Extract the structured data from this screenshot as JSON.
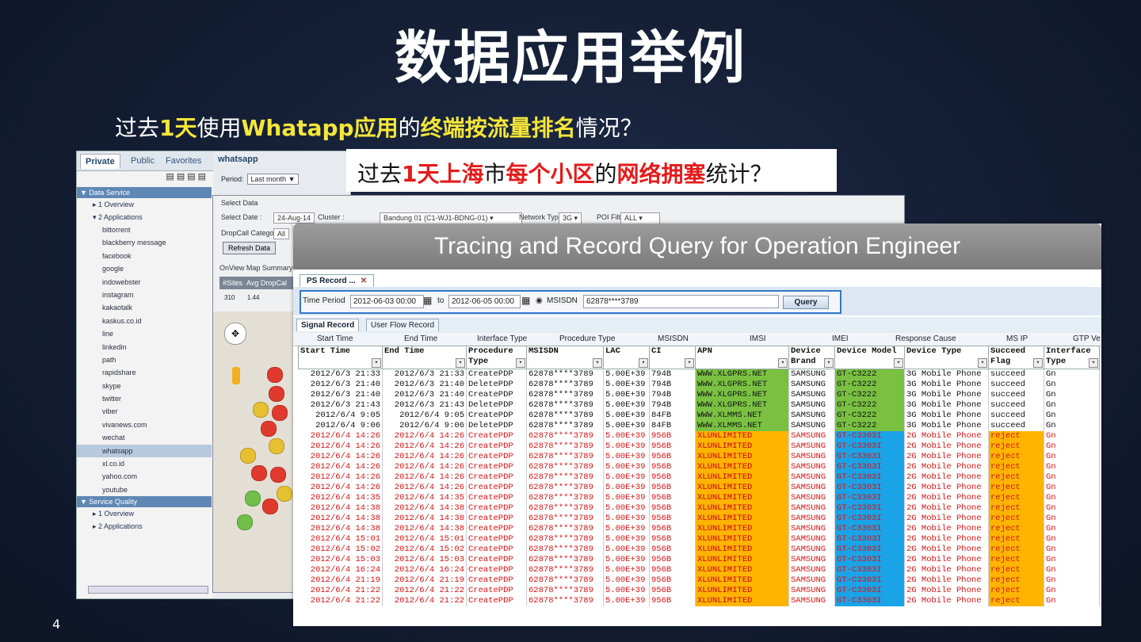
{
  "slide": {
    "title": "数据应用举例",
    "page_number": "4",
    "question1": {
      "p1": "过去",
      "p2": "1天",
      "p3": "使用",
      "p4": "Whatapp应用",
      "p5": "的",
      "p6": "终端按流量排名",
      "p7": "情况？"
    },
    "question2": {
      "p1": "过去",
      "p2": "1天上海",
      "p3": "市",
      "p4": "每个小区",
      "p5": "的",
      "p6": "网络拥塞",
      "p7": "统计？"
    }
  },
  "panel_apps": {
    "tabs": [
      "Private",
      "Public",
      "Favorites"
    ],
    "header": "whatsapp",
    "period_label": "Period:",
    "period_value": "Last month",
    "section1": "Data Service",
    "overview": "1 Overview",
    "applications": "2 Applications",
    "apps": [
      "bittorrent",
      "blackberry message",
      "facebook",
      "google",
      "indowebster",
      "instagram",
      "kakaotalk",
      "kaskus.co.id",
      "line",
      "linkedin",
      "path",
      "rapidshare",
      "skype",
      "twitter",
      "viber",
      "vivanews.com",
      "wechat",
      "whatsapp",
      "xl.co.id",
      "yahoo.com",
      "youtube"
    ],
    "selected_app": "whatsapp",
    "section2": "Service Quality",
    "sq_overview": "1 Overview",
    "sq_applications": "2 Applications"
  },
  "panel_map": {
    "select_data": "Select Data",
    "select_date_label": "Select Date :",
    "select_date_value": "24-Aug-14",
    "cluster_label": "Cluster :",
    "cluster_value": "Bandung 01 (C1-WJ1-BDNG-01)",
    "network_type_label": "Network Type",
    "network_type_value": "3G",
    "poi_filter_label": "POI Filter",
    "poi_filter_value": "ALL",
    "dropcall_label": "DropCall Category",
    "dropcall_value": "All",
    "refresh_button": "Refresh Data",
    "summary_label": "OnView Map Summary",
    "summary_headers": [
      "#Sites",
      "Avg DropCal"
    ],
    "summary_values": [
      "310",
      "1.44"
    ]
  },
  "panel_table": {
    "banner": "Tracing and Record Query for Operation Engineer",
    "tab": "PS Record ...",
    "time_period_label": "Time Period",
    "from": "2012-06-03 00:00",
    "to_label": "to",
    "to": "2012-06-05 00:00",
    "msisdn_label": "MSISDN",
    "msisdn_value": "62878****3789",
    "query_button": "Query",
    "subtabs": [
      "Signal Record",
      "User Flow Record"
    ],
    "top_columns": [
      "Start Time",
      "End Time",
      "Interface Type",
      "Procedure Type",
      "MSISDN",
      "IMSI",
      "IMEI",
      "Response Cause",
      "MS IP",
      "GTP Ve"
    ],
    "columns": [
      "Start Time",
      "End Time",
      "Procedure Type",
      "MSISDN",
      "LAC",
      "CI",
      "APN",
      "Device Brand",
      "Device Model",
      "Device Type",
      "Succeed Flag",
      "Interface Type"
    ],
    "rows": [
      [
        "2012/6/3 21:33",
        "2012/6/3 21:33",
        "CreatePDP",
        "62878****3789",
        "5.00E+39",
        "794B",
        "WWW.XLGPRS.NET",
        "SAMSUNG",
        "GT-C3222",
        "3G Mobile Phone",
        "succeed",
        "Gn"
      ],
      [
        "2012/6/3 21:40",
        "2012/6/3 21:40",
        "DeletePDP",
        "62878****3789",
        "5.00E+39",
        "794B",
        "WWW.XLGPRS.NET",
        "SAMSUNG",
        "GT-C3222",
        "3G Mobile Phone",
        "succeed",
        "Gn"
      ],
      [
        "2012/6/3 21:40",
        "2012/6/3 21:40",
        "CreatePDP",
        "62878****3789",
        "5.00E+39",
        "794B",
        "WWW.XLGPRS.NET",
        "SAMSUNG",
        "GT-C3222",
        "3G Mobile Phone",
        "succeed",
        "Gn"
      ],
      [
        "2012/6/3 21:43",
        "2012/6/3 21:43",
        "DeletePDP",
        "62878****3789",
        "5.00E+39",
        "794B",
        "WWW.XLGPRS.NET",
        "SAMSUNG",
        "GT-C3222",
        "3G Mobile Phone",
        "succeed",
        "Gn"
      ],
      [
        "2012/6/4 9:05",
        "2012/6/4 9:05",
        "CreatePDP",
        "62878****3789",
        "5.00E+39",
        "84FB",
        "WWW.XLMMS.NET",
        "SAMSUNG",
        "GT-C3222",
        "3G Mobile Phone",
        "succeed",
        "Gn"
      ],
      [
        "2012/6/4 9:06",
        "2012/6/4 9:06",
        "DeletePDP",
        "62878****3789",
        "5.00E+39",
        "84FB",
        "WWW.XLMMS.NET",
        "SAMSUNG",
        "GT-C3222",
        "3G Mobile Phone",
        "succeed",
        "Gn"
      ],
      [
        "2012/6/4 14:26",
        "2012/6/4 14:26",
        "CreatePDP",
        "62878****3789",
        "5.00E+39",
        "956B",
        "XLUNLIMITED",
        "SAMSUNG",
        "GT-C3303I",
        "2G Mobile Phone",
        "reject",
        "Gn"
      ],
      [
        "2012/6/4 14:26",
        "2012/6/4 14:26",
        "CreatePDP",
        "62878****3789",
        "5.00E+39",
        "956B",
        "XLUNLIMITED",
        "SAMSUNG",
        "GT-C3303I",
        "2G Mobile Phone",
        "reject",
        "Gn"
      ],
      [
        "2012/6/4 14:26",
        "2012/6/4 14:26",
        "CreatePDP",
        "62878****3789",
        "5.00E+39",
        "956B",
        "XLUNLIMITED",
        "SAMSUNG",
        "GT-C3303I",
        "2G Mobile Phone",
        "reject",
        "Gn"
      ],
      [
        "2012/6/4 14:26",
        "2012/6/4 14:26",
        "CreatePDP",
        "62878****3789",
        "5.00E+39",
        "956B",
        "XLUNLIMITED",
        "SAMSUNG",
        "GT-C3303I",
        "2G Mobile Phone",
        "reject",
        "Gn"
      ],
      [
        "2012/6/4 14:26",
        "2012/6/4 14:26",
        "CreatePDP",
        "62878****3789",
        "5.00E+39",
        "956B",
        "XLUNLIMITED",
        "SAMSUNG",
        "GT-C3303I",
        "2G Mobile Phone",
        "reject",
        "Gn"
      ],
      [
        "2012/6/4 14:26",
        "2012/6/4 14:26",
        "CreatePDP",
        "62878****3789",
        "5.00E+39",
        "956B",
        "XLUNLIMITED",
        "SAMSUNG",
        "GT-C3303I",
        "2G Mobile Phone",
        "reject",
        "Gn"
      ],
      [
        "2012/6/4 14:35",
        "2012/6/4 14:35",
        "CreatePDP",
        "62878****3789",
        "5.00E+39",
        "956B",
        "XLUNLIMITED",
        "SAMSUNG",
        "GT-C3303I",
        "2G Mobile Phone",
        "reject",
        "Gn"
      ],
      [
        "2012/6/4 14:38",
        "2012/6/4 14:38",
        "CreatePDP",
        "62878****3789",
        "5.00E+39",
        "956B",
        "XLUNLIMITED",
        "SAMSUNG",
        "GT-C3303I",
        "2G Mobile Phone",
        "reject",
        "Gn"
      ],
      [
        "2012/6/4 14:38",
        "2012/6/4 14:38",
        "CreatePDP",
        "62878****3789",
        "5.00E+39",
        "956B",
        "XLUNLIMITED",
        "SAMSUNG",
        "GT-C3303I",
        "2G Mobile Phone",
        "reject",
        "Gn"
      ],
      [
        "2012/6/4 14:38",
        "2012/6/4 14:38",
        "CreatePDP",
        "62878****3789",
        "5.00E+39",
        "956B",
        "XLUNLIMITED",
        "SAMSUNG",
        "GT-C3303I",
        "2G Mobile Phone",
        "reject",
        "Gn"
      ],
      [
        "2012/6/4 15:01",
        "2012/6/4 15:01",
        "CreatePDP",
        "62878****3789",
        "5.00E+39",
        "956B",
        "XLUNLIMITED",
        "SAMSUNG",
        "GT-C3303I",
        "2G Mobile Phone",
        "reject",
        "Gn"
      ],
      [
        "2012/6/4 15:02",
        "2012/6/4 15:02",
        "CreatePDP",
        "62878****3789",
        "5.00E+39",
        "956B",
        "XLUNLIMITED",
        "SAMSUNG",
        "GT-C3303I",
        "2G Mobile Phone",
        "reject",
        "Gn"
      ],
      [
        "2012/6/4 15:03",
        "2012/6/4 15:03",
        "CreatePDP",
        "62878****3789",
        "5.00E+39",
        "956B",
        "XLUNLIMITED",
        "SAMSUNG",
        "GT-C3303I",
        "2G Mobile Phone",
        "reject",
        "Gn"
      ],
      [
        "2012/6/4 16:24",
        "2012/6/4 16:24",
        "CreatePDP",
        "62878****3789",
        "5.00E+39",
        "956B",
        "XLUNLIMITED",
        "SAMSUNG",
        "GT-C3303I",
        "2G Mobile Phone",
        "reject",
        "Gn"
      ],
      [
        "2012/6/4 21:19",
        "2012/6/4 21:19",
        "CreatePDP",
        "62878****3789",
        "5.00E+39",
        "956B",
        "XLUNLIMITED",
        "SAMSUNG",
        "GT-C3303I",
        "2G Mobile Phone",
        "reject",
        "Gn"
      ],
      [
        "2012/6/4 21:22",
        "2012/6/4 21:22",
        "CreatePDP",
        "62878****3789",
        "5.00E+39",
        "956B",
        "XLUNLIMITED",
        "SAMSUNG",
        "GT-C3303I",
        "2G Mobile Phone",
        "reject",
        "Gn"
      ],
      [
        "2012/6/4 21:22",
        "2012/6/4 21:22",
        "CreatePDP",
        "62878****3789",
        "5.00E+39",
        "956B",
        "XLUNLIMITED",
        "SAMSUNG",
        "GT-C3303I",
        "2G Mobile Phone",
        "reject",
        "Gn"
      ]
    ]
  },
  "colors": {
    "success_green": "#7ac142",
    "reject_orange": "#ffb400",
    "reject_blue": "#1aa3e6",
    "highlight_yellow": "#f5e63a",
    "highlight_red": "#e41b1b"
  }
}
